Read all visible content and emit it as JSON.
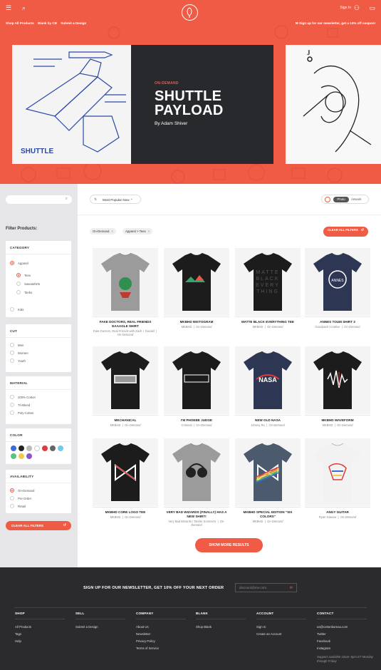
{
  "header": {
    "nav_links": [
      "Shop All Products",
      "Blank by CB",
      "Submit a Design"
    ],
    "sign_in": "Sign In",
    "promo": "Sign up for our newsletter, get a 10% off coupon!"
  },
  "hero": {
    "eyebrow": "ON-DEMAND",
    "title": "SHUTTLE PAYLOAD",
    "byline": "By Adam Shiver",
    "art_caption": "SHUTTLE",
    "side_card_label": "J"
  },
  "sidebar": {
    "search_placeholder": "",
    "filter_title": "Filter Products:",
    "category": {
      "title": "CATEGORY",
      "items": [
        "Apparel",
        "Tees",
        "Sweatshirts",
        "Tanks",
        "Kids"
      ]
    },
    "cut": {
      "title": "CUT",
      "items": [
        "Men",
        "Women",
        "Youth"
      ]
    },
    "material": {
      "title": "MATERIAL",
      "items": [
        "100% Cotton",
        "Tri-Blend",
        "Poly-Cotton"
      ]
    },
    "color": {
      "title": "COLOR",
      "swatches": [
        "#3f6bd6",
        "#222222",
        "#bbbbbb",
        "#ffffff",
        "#e03a3a",
        "#666666",
        "#74c8f0",
        "#59c37b",
        "#f1c94a",
        "#8e55c9"
      ]
    },
    "availability": {
      "title": "AVAILABILITY",
      "items": [
        "On-Demand",
        "Pre-Order",
        "Retail"
      ]
    },
    "clear_all": "CLEAR ALL FILTERS"
  },
  "toolbar": {
    "sort": "Most Popular Now",
    "view_photo": "Photo",
    "view_artwork": "Artwork",
    "chips": [
      "On-Demand",
      "Apparel > Tees"
    ],
    "clear_all": "CLEAR ALL FILTERS"
  },
  "products": [
    {
      "name": "FAKE DOCTORS, REAL FRIENDS EAAAGLE SHIRT",
      "meta1": "Fake Doctors, Real Friends with Zach + Donald",
      "meta2": "On-Demand",
      "color": "#9b9b9b"
    },
    {
      "name": "MKBHD MISTOGRAM",
      "meta1": "MKBHD",
      "meta2": "On-Demand",
      "color": "#1c1c1c"
    },
    {
      "name": "MATTE BLACK EVERYTHING TEE",
      "meta1": "MKBHD",
      "meta2": "On-Demand",
      "color": "#1c1c1c"
    },
    {
      "name": "ANNES TOUM SHIRT 3",
      "meta1": "Goodpack Creative",
      "meta2": "On-Demand",
      "color": "#2d3652"
    },
    {
      "name": "MECHANICAL",
      "meta1": "MKBHD",
      "meta2": "On-Demand",
      "color": "#1c1c1c"
    },
    {
      "name": "I'M PHOEBE JUDGE",
      "meta1": "Criminal",
      "meta2": "On-Demand",
      "color": "#1c1c1c"
    },
    {
      "name": "NEW OLD NASA",
      "meta1": "Johnny Ru",
      "meta2": "On-Demand",
      "color": "#2d3652"
    },
    {
      "name": "MKBHD WAVEFORM",
      "meta1": "MKBHD",
      "meta2": "On-Demand",
      "color": "#1c1c1c"
    },
    {
      "name": "MKBHD CORE LOGO TEE",
      "meta1": "MKBHD",
      "meta2": "On-Demand",
      "color": "#1c1c1c"
    },
    {
      "name": "VERY BAD WIZARDS (FINALLY) HAS A NEW SHIRT!",
      "meta1": "Very Bad Wizards / Tamler Sommers",
      "meta2": "On-Demand",
      "color": "#9b9b9b"
    },
    {
      "name": "MKBHD SPECIAL EDITION \"SIX COLORS\"",
      "meta1": "MKBHD",
      "meta2": "On-Demand",
      "color": "#4c5a6e"
    },
    {
      "name": "ANGY GUITAR",
      "meta1": "Ryan Glasow",
      "meta2": "On-Demand",
      "color": "#f2f2f2"
    }
  ],
  "show_more": "SHOW MORE RESULTS",
  "footer": {
    "newsletter": "SIGN UP FOR OUR NEWSLETTER, GET 10% OFF YOUR NEXT ORDER",
    "email_placeholder": "discount@me.com",
    "columns": [
      {
        "title": "SHOP",
        "links": [
          "All Products",
          "Tags",
          "Help"
        ]
      },
      {
        "title": "SELL",
        "links": [
          "Submit a Design"
        ]
      },
      {
        "title": "COMPANY",
        "links": [
          "About Us",
          "Newsletter",
          "Privacy Policy",
          "Terms of Service"
        ]
      },
      {
        "title": "BLANK",
        "links": [
          "Shop Blank"
        ]
      },
      {
        "title": "ACCOUNT",
        "links": [
          "Sign In",
          "Create an Account"
        ]
      },
      {
        "title": "CONTACT",
        "links": [
          "us@cottonbureau.com",
          "Twitter",
          "Facebook",
          "Instagram"
        ]
      }
    ],
    "support": "Support available 10am–5pm ET Monday through Friday"
  }
}
